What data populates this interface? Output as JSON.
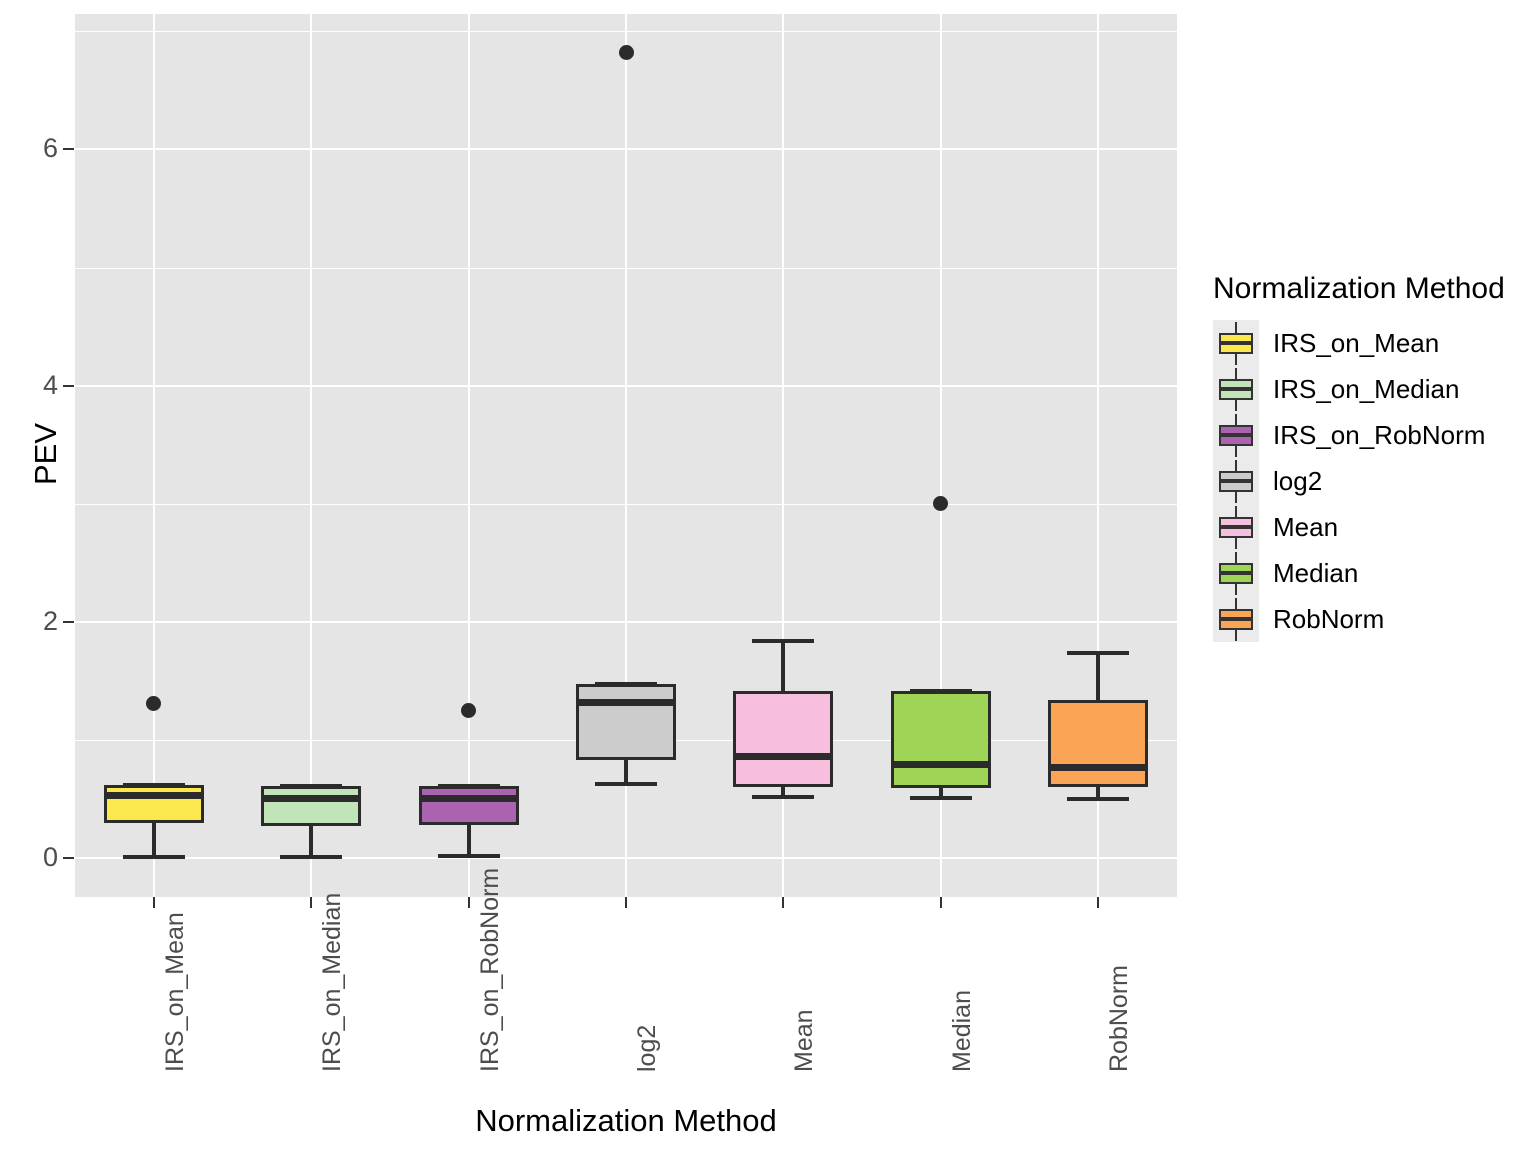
{
  "axes": {
    "x_title": "Normalization Method",
    "y_title": "PEV",
    "y_ticks": [
      "0",
      "2",
      "4",
      "6"
    ],
    "x_ticks": [
      "IRS_on_Mean",
      "IRS_on_Median",
      "IRS_on_RobNorm",
      "log2",
      "Mean",
      "Median",
      "RobNorm"
    ]
  },
  "legend": {
    "title": "Normalization Method",
    "items": [
      {
        "label": "IRS_on_Mean",
        "color": "#fbe84f"
      },
      {
        "label": "IRS_on_Median",
        "color": "#c1e5b8"
      },
      {
        "label": "IRS_on_RobNorm",
        "color": "#ab62b0"
      },
      {
        "label": "log2",
        "color": "#cccccc"
      },
      {
        "label": "Mean",
        "color": "#f7bede"
      },
      {
        "label": "Median",
        "color": "#9ed556"
      },
      {
        "label": "RobNorm",
        "color": "#faa455"
      }
    ]
  },
  "chart_data": {
    "type": "boxplot",
    "title": "",
    "xlabel": "Normalization Method",
    "ylabel": "PEV",
    "ylim": [
      -0.35,
      7.15
    ],
    "y_ticks": [
      0,
      2,
      4,
      6
    ],
    "grid": true,
    "legend_position": "right",
    "legend_title": "Normalization Method",
    "categories": [
      "IRS_on_Mean",
      "IRS_on_Median",
      "IRS_on_RobNorm",
      "log2",
      "Mean",
      "Median",
      "RobNorm"
    ],
    "boxes": [
      {
        "category": "IRS_on_Mean",
        "color": "#fbe84f",
        "whisker_low": 0.01,
        "q1": 0.3,
        "median": 0.525,
        "q3": 0.62,
        "whisker_high": 0.62,
        "outliers": [
          1.31
        ]
      },
      {
        "category": "IRS_on_Median",
        "color": "#c1e5b8",
        "whisker_low": 0.01,
        "q1": 0.27,
        "median": 0.5,
        "q3": 0.61,
        "whisker_high": 0.61,
        "outliers": []
      },
      {
        "category": "IRS_on_RobNorm",
        "color": "#ab62b0",
        "whisker_low": 0.02,
        "q1": 0.28,
        "median": 0.5,
        "q3": 0.61,
        "whisker_high": 0.61,
        "outliers": [
          1.25
        ]
      },
      {
        "category": "log2",
        "color": "#cccccc",
        "whisker_low": 0.63,
        "q1": 0.83,
        "median": 1.32,
        "q3": 1.47,
        "whisker_high": 1.47,
        "outliers": [
          6.82
        ]
      },
      {
        "category": "Mean",
        "color": "#f7bede",
        "whisker_low": 0.52,
        "q1": 0.6,
        "median": 0.86,
        "q3": 1.41,
        "whisker_high": 1.84,
        "outliers": []
      },
      {
        "category": "Median",
        "color": "#9ed556",
        "whisker_low": 0.51,
        "q1": 0.59,
        "median": 0.79,
        "q3": 1.41,
        "whisker_high": 1.41,
        "outliers": [
          3.0
        ]
      },
      {
        "category": "RobNorm",
        "color": "#faa455",
        "whisker_low": 0.5,
        "q1": 0.6,
        "median": 0.77,
        "q3": 1.34,
        "whisker_high": 1.74,
        "outliers": []
      }
    ]
  }
}
